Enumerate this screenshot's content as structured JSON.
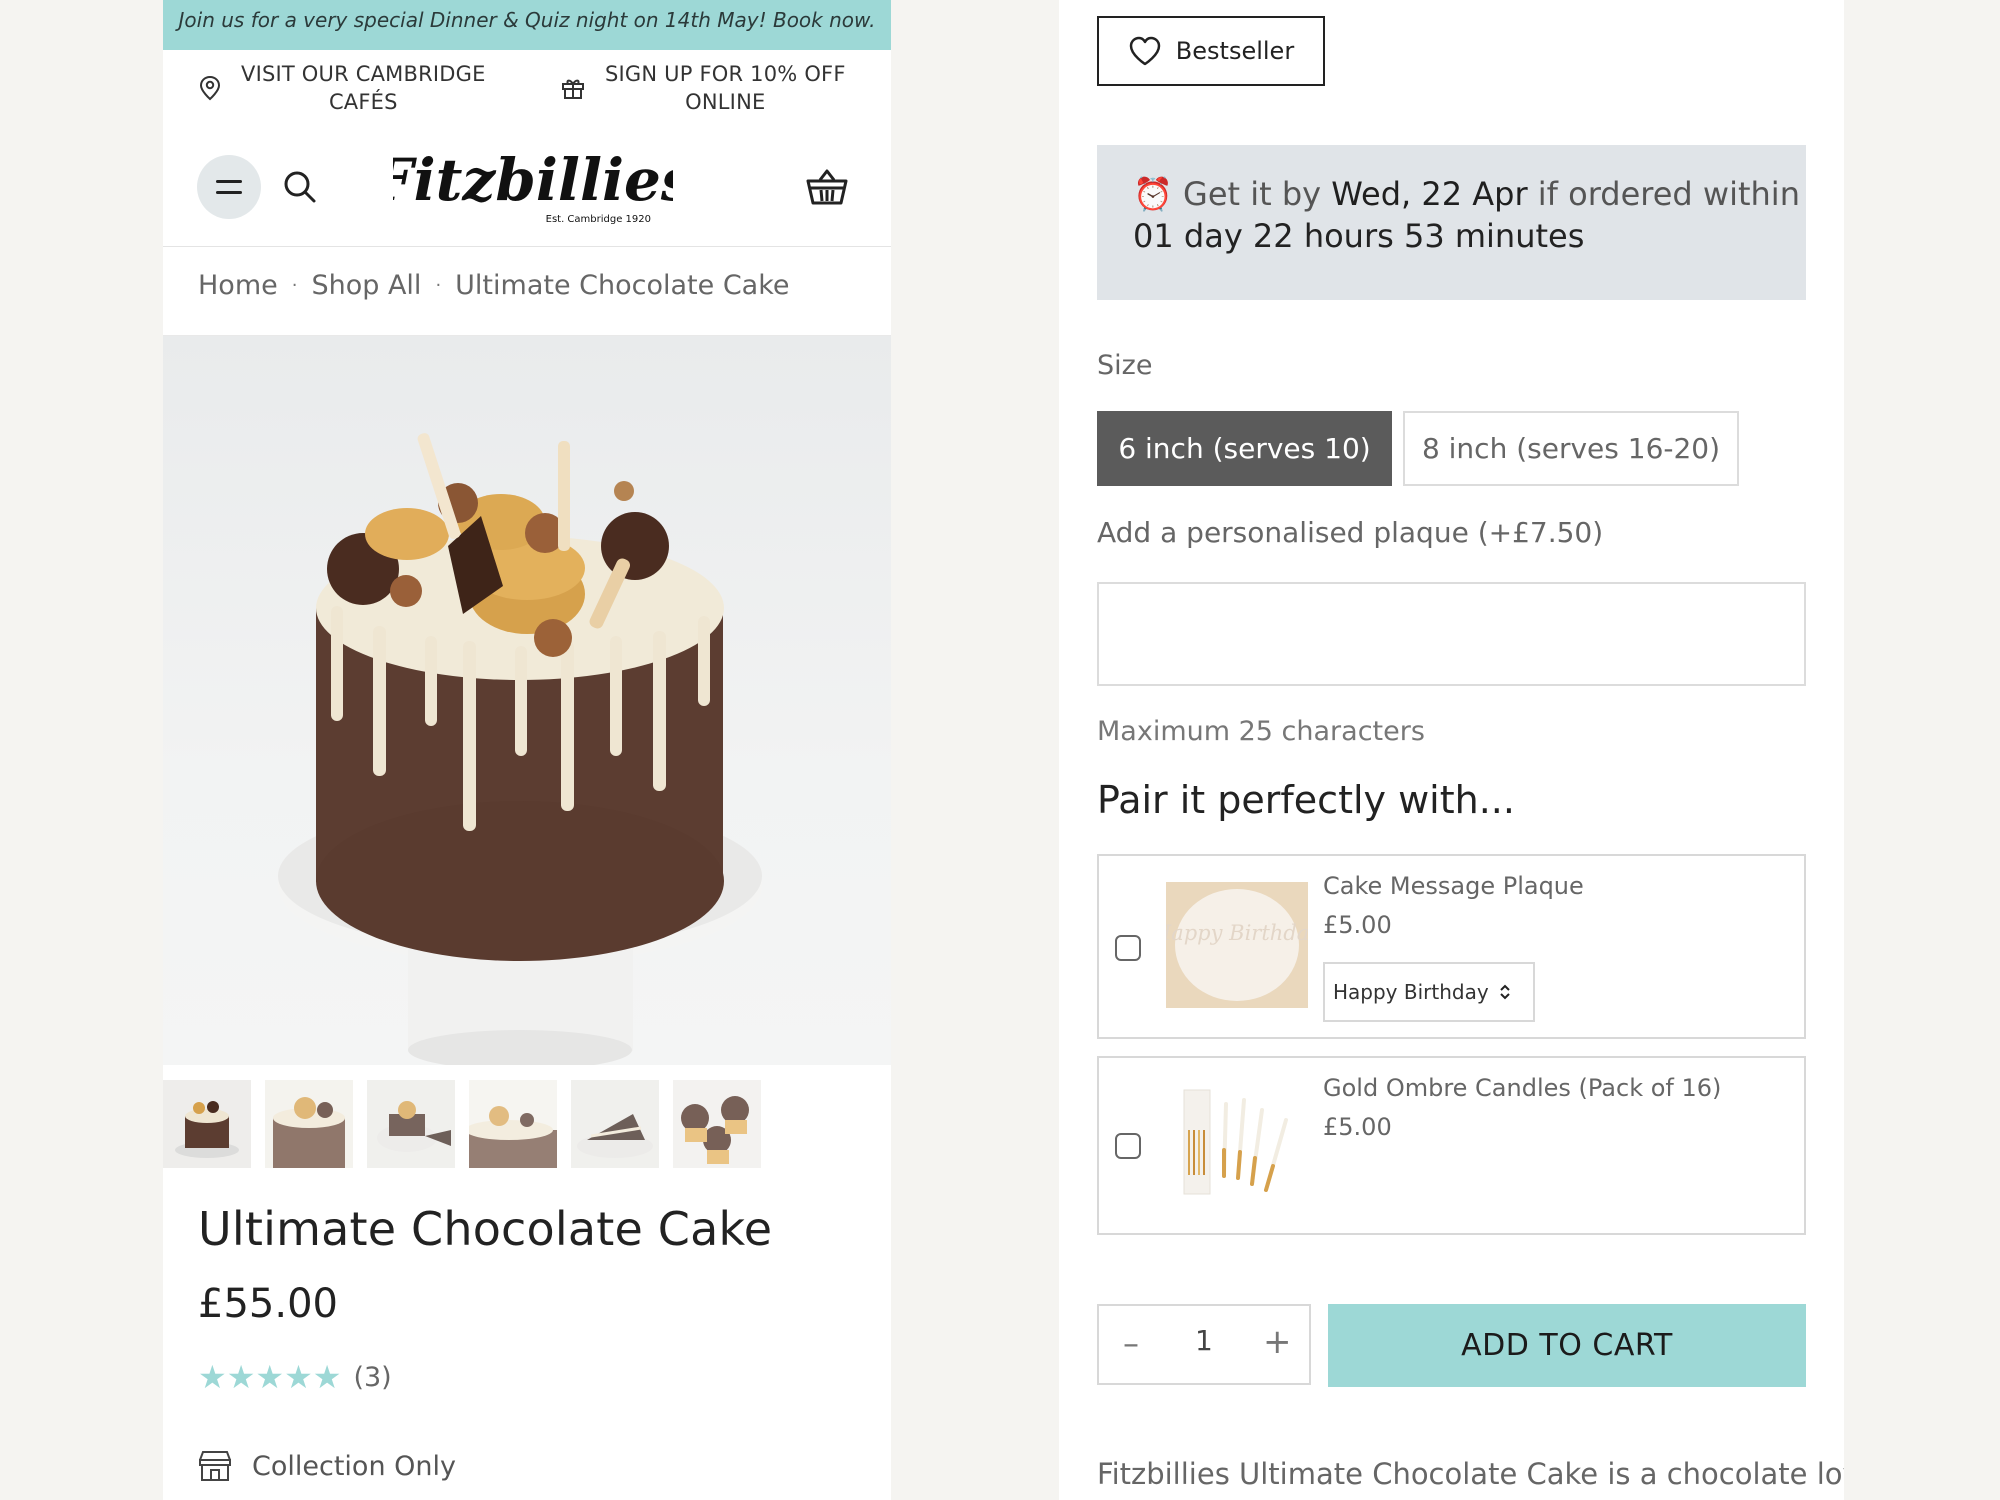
{
  "colors": {
    "accent": "#9dd8d6",
    "selected_size": "#5b5b5b",
    "delivery_bg": "#e0e4e8"
  },
  "announcement": "Join us for a very special Dinner & Quiz night on 14th May! Book now.",
  "promos": [
    {
      "icon": "location-pin-icon",
      "line1": "VISIT OUR CAMBRIDGE",
      "line2": "CAFÉS"
    },
    {
      "icon": "gift-icon",
      "line1": "SIGN UP FOR 10% OFF",
      "line2": "ONLINE"
    }
  ],
  "header": {
    "logo_text": "Fitzbillies",
    "logo_tagline": "Est. Cambridge 1920",
    "icons": [
      "menu-icon",
      "search-icon",
      "basket-icon"
    ]
  },
  "breadcrumb": {
    "items": [
      "Home",
      "Shop All",
      "Ultimate Chocolate Cake"
    ],
    "separator": "·"
  },
  "gallery": {
    "thumbnail_count": 6
  },
  "product": {
    "title": "Ultimate Chocolate Cake",
    "price": "£55.00",
    "rating": 5,
    "stars": "★★★★★",
    "review_count": "(3)",
    "fulfilment": "Collection Only"
  },
  "badge": {
    "label": "Bestseller",
    "icon": "heart-icon"
  },
  "delivery": {
    "emoji": "⏰",
    "prefix": "Get it by",
    "date": "Wed, 22 Apr",
    "suffix": "if ordered within",
    "countdown": "01 day 22 hours 53 minutes"
  },
  "size": {
    "label": "Size",
    "options": [
      "6 inch (serves 10)",
      "8 inch (serves 16-20)"
    ],
    "selected": "6 inch (serves 10)"
  },
  "plaque": {
    "label": "Add a personalised plaque (+£7.50)",
    "value": "",
    "hint": "Maximum 25 characters"
  },
  "pair": {
    "title": "Pair it perfectly with...",
    "items": [
      {
        "name": "Cake Message Plaque",
        "price": "£5.00",
        "checked": false,
        "image_text": "Happy Birthday",
        "option_selected": "Happy Birthday"
      },
      {
        "name": "Gold Ombre Candles (Pack of 16)",
        "price": "£5.00",
        "checked": false
      }
    ]
  },
  "cart": {
    "quantity": "1",
    "minus": "–",
    "plus": "+",
    "add_label": "ADD TO CART"
  },
  "description": "Fitzbillies Ultimate Chocolate Cake is a chocolate lover's"
}
